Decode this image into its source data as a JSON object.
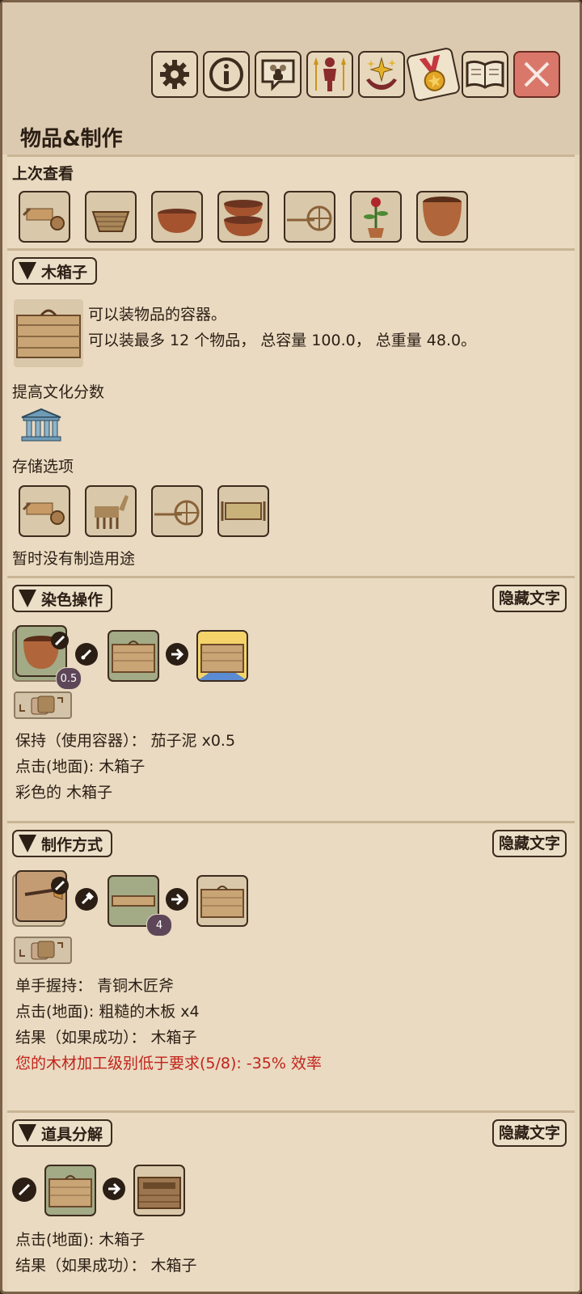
{
  "toolbar": {
    "buttons": [
      {
        "icon": "gear-icon"
      },
      {
        "icon": "info-icon"
      },
      {
        "icon": "chat-people-icon"
      },
      {
        "icon": "character-icon"
      },
      {
        "icon": "sparkle-hands-icon"
      },
      {
        "icon": "medal-icon"
      },
      {
        "icon": "book-icon"
      },
      {
        "icon": "close-icon"
      }
    ]
  },
  "page": {
    "title": "物品&制作"
  },
  "recent": {
    "label": "上次查看",
    "items": [
      "wheelbarrow-icon",
      "basket-icon",
      "bowl-icon",
      "stacked-pots-icon",
      "handcart-icon",
      "potted-flower-icon",
      "clay-pot-icon"
    ]
  },
  "item": {
    "header": "木箱子",
    "desc_line1": "可以装物品的容器。",
    "desc_line2": "可以装最多 12 个物品， 总容量 100.0， 总重量 48.0。",
    "culture_label": "提高文化分数",
    "storage_label": "存储选项",
    "storage_items": [
      "wheelbarrow-icon",
      "llama-icon",
      "handcart-icon",
      "stretcher-icon"
    ],
    "no_use_label": "暂时没有制造用途"
  },
  "dye": {
    "header": "染色操作",
    "hide_label": "隐藏文字",
    "badge": "0.5",
    "line1": "保持（使用容器）：  茄子泥 x0.5",
    "line2": "点击(地面): 木箱子",
    "line3": "彩色的 木箱子"
  },
  "craft": {
    "header": "制作方式",
    "hide_label": "隐藏文字",
    "badge": "4",
    "line1": "单手握持：  青铜木匠斧",
    "line2": "点击(地面): 粗糙的木板 x4",
    "line3": "结果（如果成功）：  木箱子",
    "warning": "您的木材加工级别低于要求(5/8): -35% 效率"
  },
  "disassemble": {
    "header": "道具分解",
    "hide_label": "隐藏文字",
    "line1": "点击(地面): 木箱子",
    "line2": "结果（如果成功）：  木箱子"
  },
  "colors": {
    "panel": "#e6d6bc",
    "border": "#3d2c1e",
    "warning": "#c2231b",
    "close": "#d9786a"
  }
}
